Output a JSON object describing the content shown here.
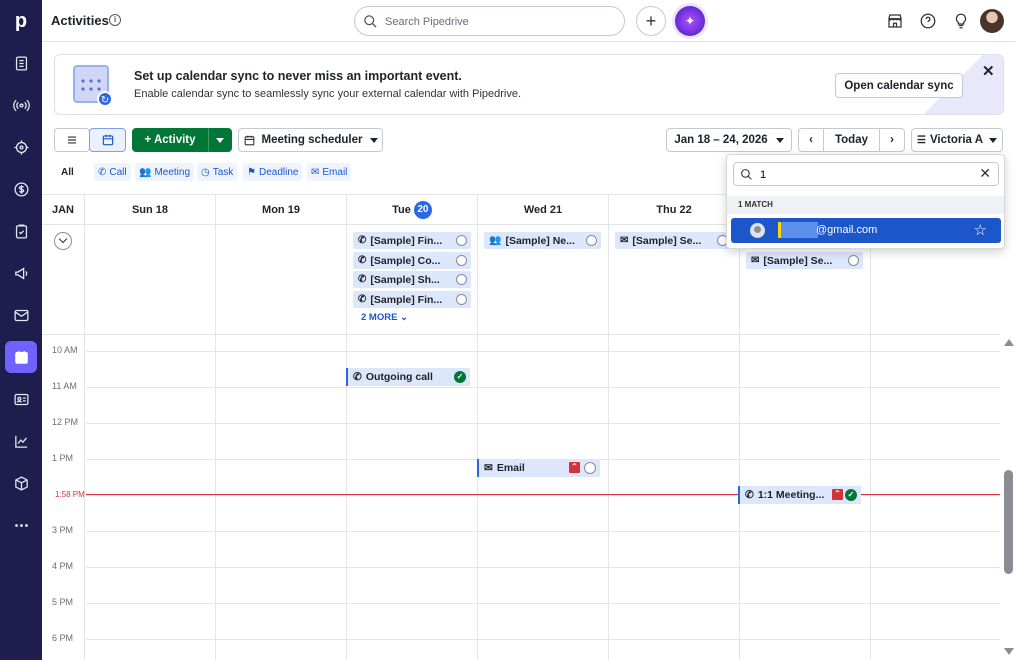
{
  "app": {
    "logo": "p"
  },
  "sidebar": {
    "items": [
      {
        "name": "deals-icon"
      },
      {
        "name": "leads-icon"
      },
      {
        "name": "projects-icon"
      },
      {
        "name": "money-icon"
      },
      {
        "name": "tasks-icon"
      },
      {
        "name": "campaigns-icon"
      },
      {
        "name": "mail-icon"
      },
      {
        "name": "calendar-icon",
        "active": true
      },
      {
        "name": "contacts-icon"
      },
      {
        "name": "insights-icon"
      },
      {
        "name": "products-icon"
      },
      {
        "name": "more-icon"
      }
    ]
  },
  "header": {
    "title": "Activities",
    "search_placeholder": "Search Pipedrive"
  },
  "banner": {
    "title": "Set up calendar sync to never miss an important event.",
    "description": "Enable calendar sync to seamlessly sync your external calendar with Pipedrive.",
    "button": "Open calendar sync"
  },
  "toolbar": {
    "activity_button": "+ Activity",
    "scheduler": "Meeting scheduler",
    "date_range": "Jan 18 – 24, 2026",
    "today": "Today",
    "user": "Victoria A"
  },
  "filters": {
    "all": "All",
    "types": [
      "Call",
      "Meeting",
      "Task",
      "Deadline",
      "Email"
    ]
  },
  "calendar": {
    "month": "JAN",
    "days": [
      {
        "name": "Sun",
        "date": "18"
      },
      {
        "name": "Mon",
        "date": "19"
      },
      {
        "name": "Tue",
        "date": "20",
        "today": true
      },
      {
        "name": "Wed",
        "date": "21"
      },
      {
        "name": "Thu",
        "date": "22"
      }
    ],
    "allday_events": [
      {
        "day": 2,
        "row": 0,
        "icon": "call",
        "title": "[Sample] Fin..."
      },
      {
        "day": 2,
        "row": 1,
        "icon": "call",
        "title": "[Sample] Co..."
      },
      {
        "day": 2,
        "row": 2,
        "icon": "call",
        "title": "[Sample] Sh..."
      },
      {
        "day": 2,
        "row": 3,
        "icon": "call",
        "title": "[Sample] Fin..."
      },
      {
        "day": 3,
        "row": 0,
        "icon": "meeting",
        "title": "[Sample] Ne..."
      },
      {
        "day": 4,
        "row": 0,
        "icon": "email",
        "title": "[Sample] Se..."
      },
      {
        "day": 5,
        "row": 1,
        "icon": "email",
        "title": "[Sample] Se..."
      }
    ],
    "more_label": "2 MORE",
    "hours": [
      "10 AM",
      "11 AM",
      "12 PM",
      "1 PM",
      "2 PM",
      "3 PM",
      "4 PM",
      "5 PM",
      "6 PM"
    ],
    "now_label": "1:58 PM",
    "timed_events": [
      {
        "title": "Outgoing call",
        "icon": "call",
        "done": true
      },
      {
        "title": "Email",
        "icon": "email",
        "priority": true
      },
      {
        "title": "1:1 Meeting...",
        "icon": "call",
        "priority": true,
        "done": true
      }
    ]
  },
  "user_dropdown": {
    "query": "1",
    "count_label": "1 MATCH",
    "result_email": "@gmail.com"
  },
  "colors": {
    "sidebar": "#1f1d4d",
    "accent": "#017737",
    "link": "#1c57c9",
    "now_line": "#d0343a",
    "selected": "#1c57c9"
  }
}
